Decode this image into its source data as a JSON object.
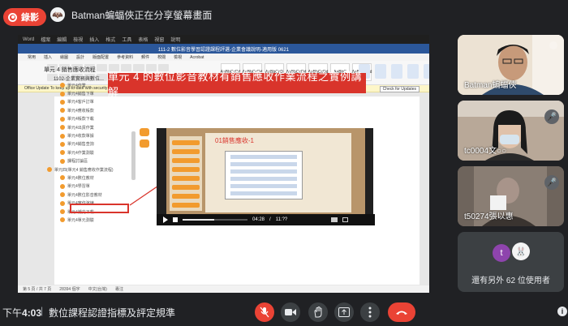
{
  "recording": {
    "label": "錄影"
  },
  "presenter": {
    "avatar_letter": "🦇",
    "text": "Batman蝙蝠俠正在分享螢幕畫面"
  },
  "share": {
    "mac_menu": [
      "Word",
      "檔案",
      "編輯",
      "檢視",
      "插入",
      "格式",
      "工具",
      "表格",
      "視窗",
      "說明"
    ],
    "doc_title": "111-2 數位影音學習認證課程評選-企業會議說明-適用版 0621",
    "ribbon_tabs": [
      "常用",
      "插入",
      "繪圖",
      "設計",
      "版面配置",
      "參考資料",
      "郵件",
      "校閱",
      "檢視",
      "Acrobat"
    ],
    "style_names": [
      "AaBbCcDd",
      "AaBbCcDd",
      "AaBbCcD",
      "AaBbCcDd",
      "AaBbCcDd",
      "AaBbC",
      "AaBbCcDd"
    ],
    "update_text": "Office Update  To keep up-to-date with security updates, fixes, and improvements, choose Check for Updates.",
    "update_button": "Check for Updates",
    "heading": "單元 4 銷售應收流程",
    "sub": "1102-企業實務與數位...",
    "tree": [
      {
        "label": "單元4作業...",
        "indent": true
      },
      {
        "label": "單元4銷售下單",
        "indent": true
      },
      {
        "label": "單元4客戶訂單",
        "indent": true
      },
      {
        "label": "單元4應收帳款",
        "indent": true
      },
      {
        "label": "單元4帳款下載",
        "indent": true
      },
      {
        "label": "單元4出貨作業",
        "indent": true
      },
      {
        "label": "單元4收款單據",
        "indent": true
      },
      {
        "label": "單元4銷售查詢",
        "indent": true
      },
      {
        "label": "單元4作業測驗",
        "indent": true
      },
      {
        "label": "課程討論區",
        "indent": true
      },
      {
        "label": "單元四(單元4 銷售應收作業流程)",
        "indent": false
      },
      {
        "label": "單元4數位教材",
        "indent": true
      },
      {
        "label": "單元4學習單",
        "indent": true
      },
      {
        "label": "單元4數位影音教材",
        "indent": true,
        "selected": true
      },
      {
        "label": "單元4實作演練",
        "indent": true
      },
      {
        "label": "單元4補充下載",
        "indent": true
      },
      {
        "label": "單元4單元測驗",
        "indent": true
      }
    ],
    "banner": "單元 4 的數位影音教材有銷售應收作業流程之實例講解",
    "video": {
      "slide_title": "01銷售應收-1",
      "time_current": "04:28",
      "time_total": "11:??",
      "progress": 0.49
    },
    "statusbar": [
      "第 5 頁 / 共 7 頁",
      "28394 個字",
      "中文(台灣)",
      "專注"
    ]
  },
  "participants": [
    {
      "name": "Batman蝙蝠俠",
      "bg": "#f0e6d8"
    },
    {
      "name": "tc0004文○○",
      "bg": "#b9a99a"
    },
    {
      "name": "t50274張以惠",
      "bg": "#6d625b"
    }
  ],
  "others": {
    "label": "還有另外 62 位使用者",
    "avatars": [
      "t",
      "🐰"
    ]
  },
  "bottom": {
    "time_prefix": "下午",
    "time": "4:03",
    "separator": "|",
    "meeting_title": "數位課程認證指標及評定規準"
  },
  "colors": {
    "accent_red": "#ea4335",
    "panel": "#3c4043",
    "bg": "#202124"
  }
}
